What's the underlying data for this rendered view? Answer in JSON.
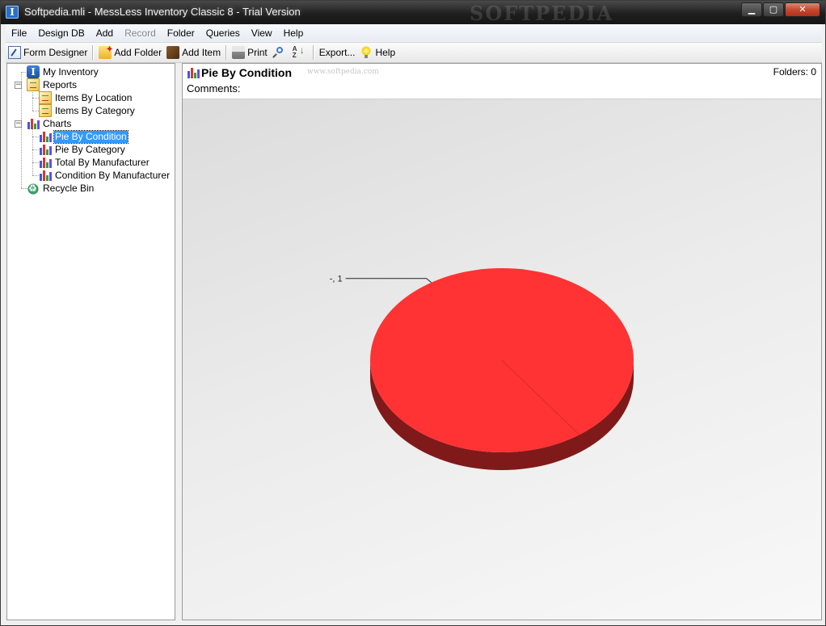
{
  "window": {
    "title": "Softpedia.mli - MessLess Inventory Classic 8 - Trial Version",
    "watermark": "SOFTPEDIA",
    "controls": {
      "minimize": "▁",
      "maximize": "▢",
      "close": "✕"
    }
  },
  "menu": [
    {
      "label": "File",
      "enabled": true
    },
    {
      "label": "Design DB",
      "enabled": true
    },
    {
      "label": "Add",
      "enabled": true
    },
    {
      "label": "Record",
      "enabled": false
    },
    {
      "label": "Folder",
      "enabled": true
    },
    {
      "label": "Queries",
      "enabled": true
    },
    {
      "label": "View",
      "enabled": true
    },
    {
      "label": "Help",
      "enabled": true
    }
  ],
  "toolbar": {
    "form_designer": "Form Designer",
    "add_folder": "Add Folder",
    "add_item": "Add Item",
    "print": "Print",
    "export": "Export...",
    "help": "Help"
  },
  "tree": {
    "root": "My Inventory",
    "reports": "Reports",
    "report_items": [
      "Items By Location",
      "Items By Category"
    ],
    "charts": "Charts",
    "chart_items": [
      "Pie By Condition",
      "Pie By Category",
      "Total By Manufacturer",
      "Condition By Manufacturer"
    ],
    "selected": "Pie By Condition",
    "recycle_bin": "Recycle Bin"
  },
  "main": {
    "title": "Pie By Condition",
    "watermark": "www.softpedia.com",
    "folders": "Folders: 0",
    "comments_label": "Comments:"
  },
  "chart_data": {
    "type": "pie",
    "style": "3d",
    "slices": [
      {
        "label": "-",
        "value": 1,
        "color": "#ff3333"
      }
    ],
    "data_labels": [
      "-, 1"
    ]
  }
}
